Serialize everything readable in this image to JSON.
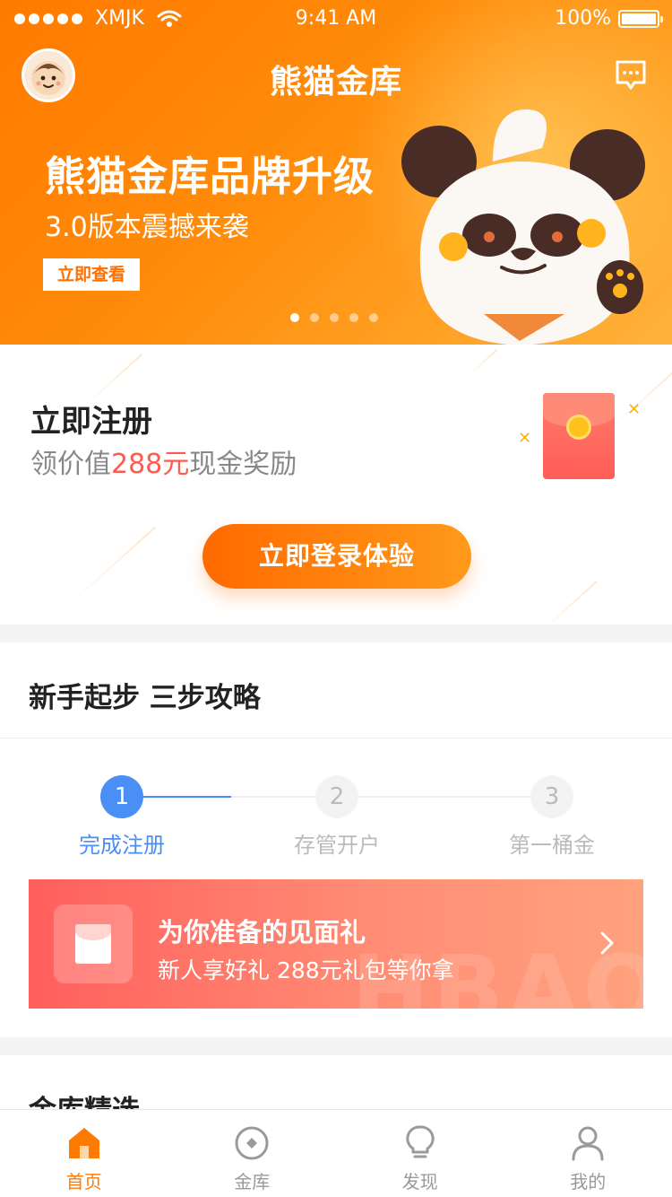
{
  "status_bar": {
    "carrier": "XMJK",
    "time": "9:41 AM",
    "battery": "100%"
  },
  "header": {
    "app_title": "熊猫金库"
  },
  "banner": {
    "title": "熊猫金库品牌升级",
    "subtitle": "3.0版本震撼来袭",
    "button_label": "立即查看",
    "page_count": 5,
    "active_page": 1
  },
  "register": {
    "title": "立即注册",
    "subtitle_prefix": "领价值",
    "subtitle_amount": "288元",
    "subtitle_suffix": "现金奖励",
    "login_button": "立即登录体验"
  },
  "guide": {
    "title": "新手起步 三步攻略",
    "steps": [
      {
        "number": "1",
        "label": "完成注册",
        "active": true
      },
      {
        "number": "2",
        "label": "存管开户",
        "active": false
      },
      {
        "number": "3",
        "label": "第一桶金",
        "active": false
      }
    ],
    "gift": {
      "title": "为你准备的见面礼",
      "subtitle": "新人享好礼 288元礼包等你拿",
      "watermark": "HBAO"
    }
  },
  "selection": {
    "title": "金库精选"
  },
  "tabbar": {
    "items": [
      {
        "label": "首页",
        "icon": "home-icon",
        "active": true
      },
      {
        "label": "金库",
        "icon": "vault-icon",
        "active": false
      },
      {
        "label": "发现",
        "icon": "bulb-icon",
        "active": false
      },
      {
        "label": "我的",
        "icon": "user-icon",
        "active": false
      }
    ]
  },
  "colors": {
    "accent": "#ff7a00",
    "step_active": "#4a8ff5",
    "highlight_red": "#ff5a4e"
  }
}
